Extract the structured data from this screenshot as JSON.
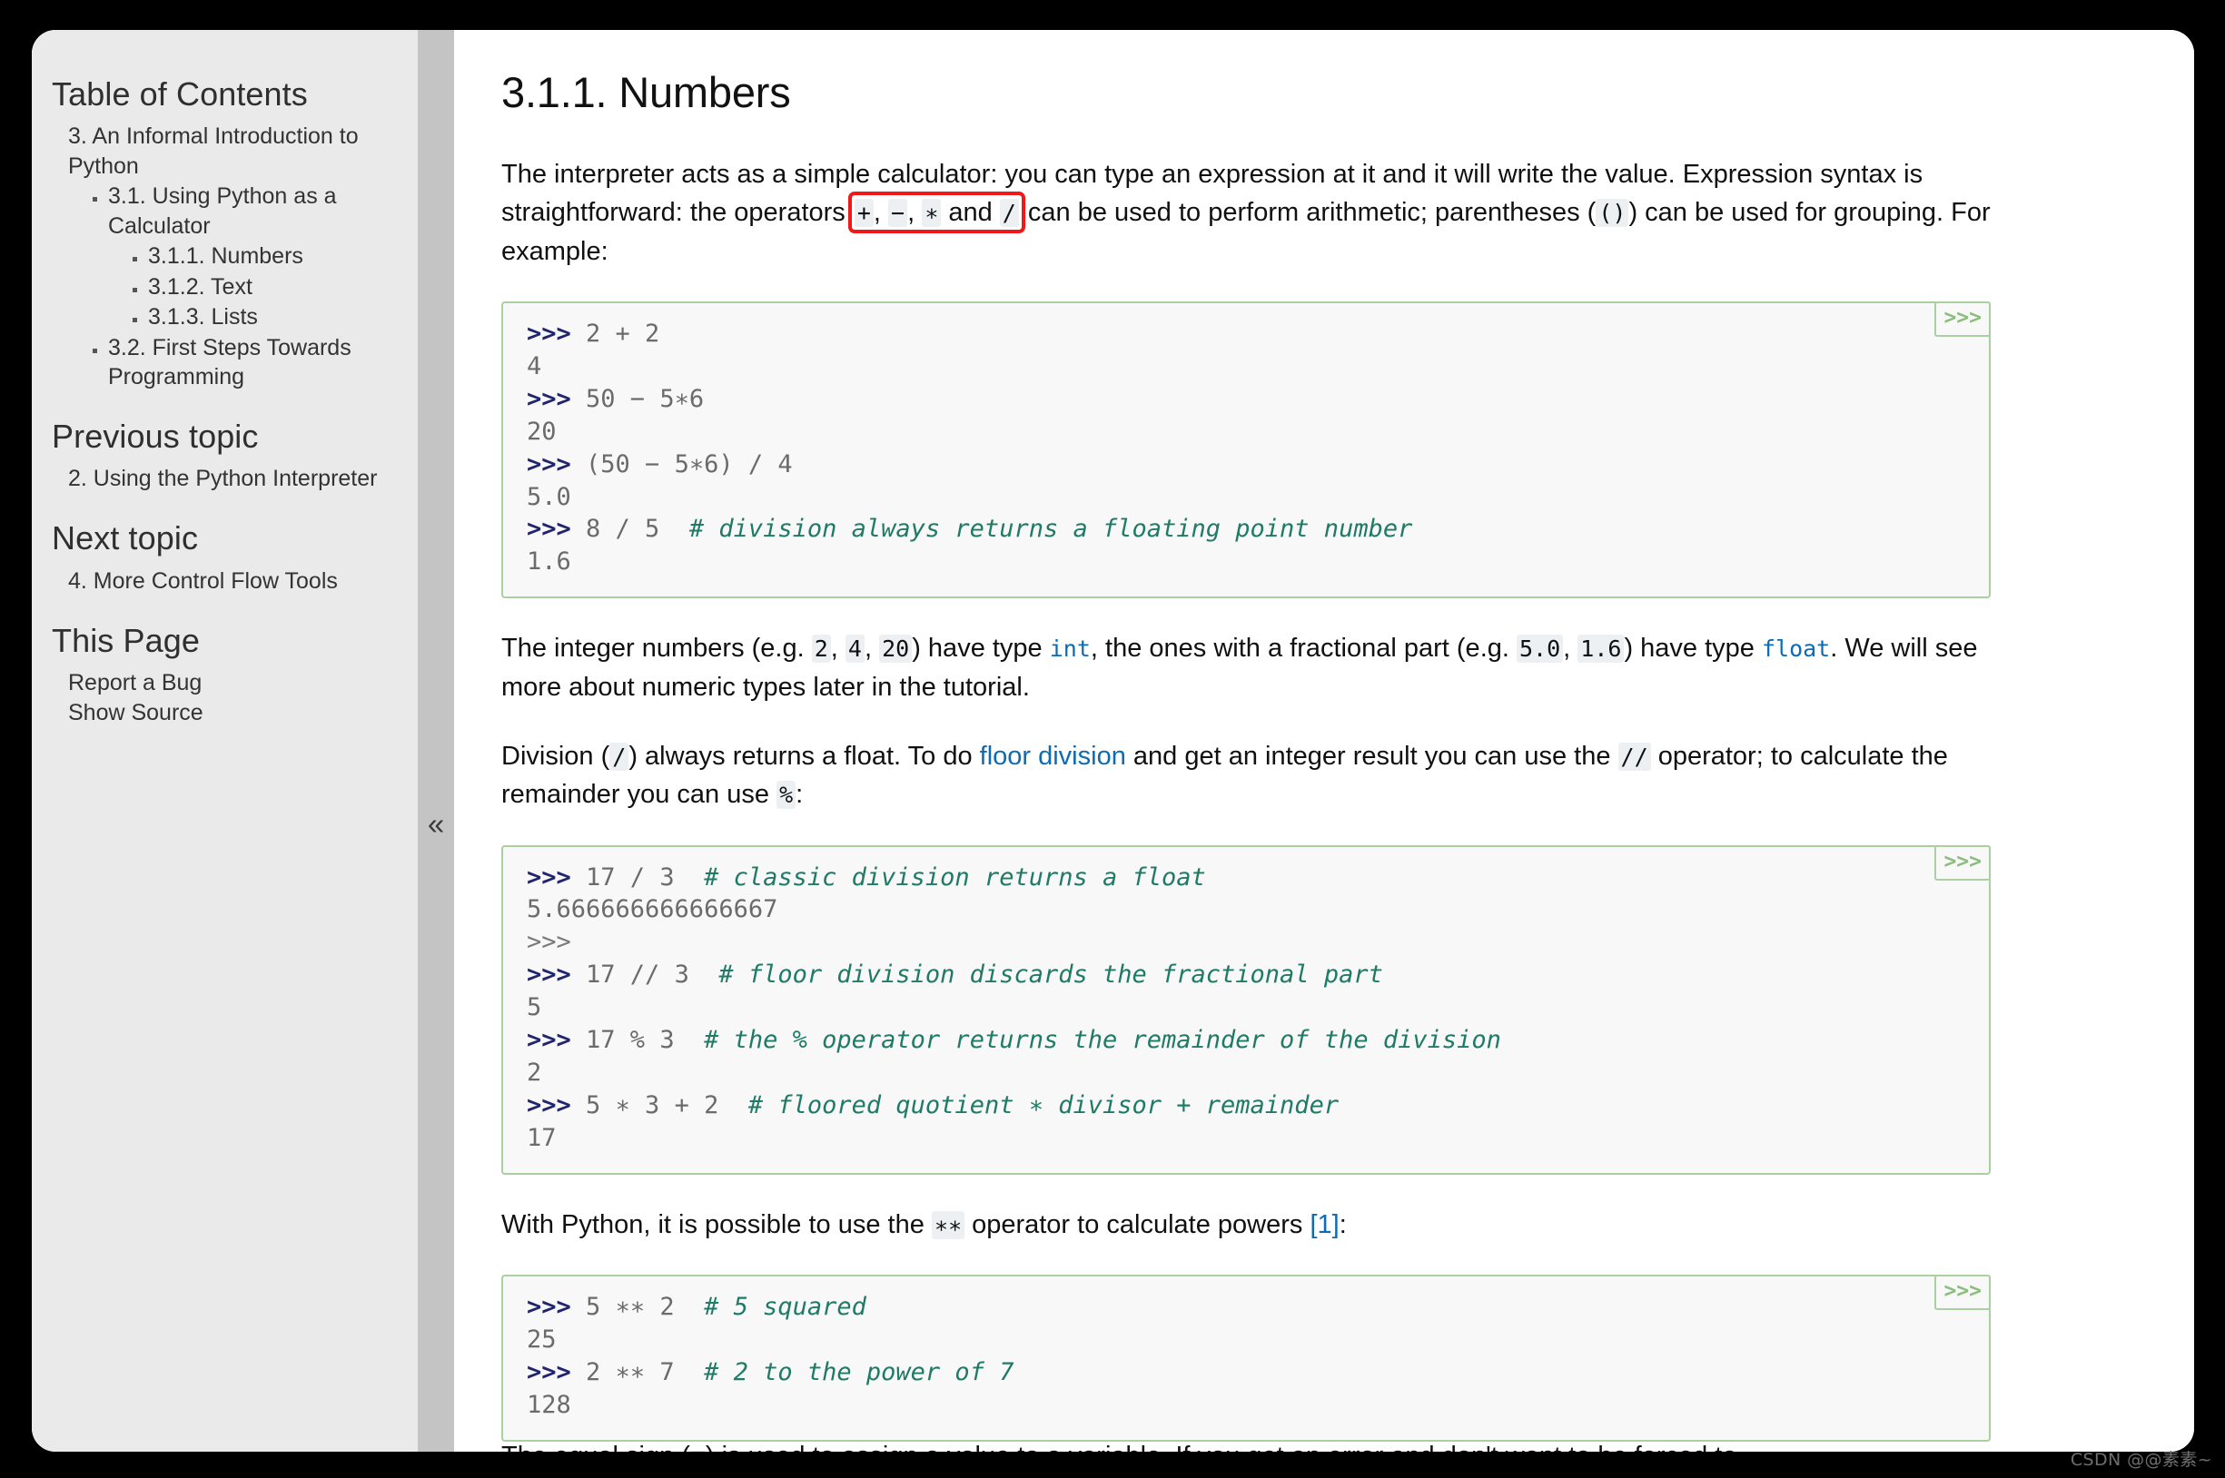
{
  "sidebar": {
    "toc_heading": "Table of Contents",
    "toc": {
      "root_label": "3. An Informal Introduction to Python",
      "children": [
        {
          "label": "3.1. Using Python as a Calculator",
          "children": [
            {
              "label": "3.1.1. Numbers"
            },
            {
              "label": "3.1.2. Text"
            },
            {
              "label": "3.1.3. Lists"
            }
          ]
        },
        {
          "label": "3.2. First Steps Towards Programming"
        }
      ]
    },
    "previous_topic_heading": "Previous topic",
    "previous_topic_link": "2. Using the Python Interpreter",
    "next_topic_heading": "Next topic",
    "next_topic_link": "4. More Control Flow Tools",
    "this_page_heading": "This Page",
    "this_page_links": [
      "Report a Bug",
      "Show Source"
    ],
    "collapse_glyph": "«"
  },
  "main": {
    "title": "3.1.1. Numbers",
    "para1": {
      "t1": "The interpreter acts as a simple calculator: you can type an expression at it and it will write the value. Expression syntax is straightforward: the operators ",
      "ops": [
        "+",
        ", ",
        "−",
        ", ",
        "∗",
        " and ",
        "/"
      ],
      "op_plus": "+",
      "op_minus": "−",
      "op_times": "∗",
      "op_div": "/",
      "op_sep1": ", ",
      "op_sep2": ", ",
      "op_and": " and ",
      "t2": " can be used to perform arithmetic; parentheses (",
      "parens": "()",
      "t3": ") can be used for grouping. For example:"
    },
    "code1": {
      "button_label": ">>>",
      "lines": [
        {
          "prompt": ">>>",
          "code": " 2 + 2",
          "comment": ""
        },
        {
          "prompt": "",
          "code": "4",
          "comment": ""
        },
        {
          "prompt": ">>>",
          "code": " 50 − 5∗6",
          "comment": ""
        },
        {
          "prompt": "",
          "code": "20",
          "comment": ""
        },
        {
          "prompt": ">>>",
          "code": " (50 − 5∗6) / 4",
          "comment": ""
        },
        {
          "prompt": "",
          "code": "5.0",
          "comment": ""
        },
        {
          "prompt": ">>>",
          "code": " 8 / 5  ",
          "comment": "# division always returns a floating point number"
        },
        {
          "prompt": "",
          "code": "1.6",
          "comment": ""
        }
      ]
    },
    "para2": {
      "t1": "The integer numbers (e.g. ",
      "c1": "2",
      "s1": ", ",
      "c2": "4",
      "s2": ", ",
      "c3": "20",
      "t2": ") have type ",
      "link_int": "int",
      "t3": ", the ones with a fractional part (e.g. ",
      "c4": "5.0",
      "s3": ", ",
      "c5": "1.6",
      "t4": ") have type ",
      "link_float": "float",
      "t5": ". We will see more about numeric types later in the tutorial."
    },
    "para3": {
      "t1": "Division (",
      "c1": "/",
      "t2": ") always returns a float. To do ",
      "link_floor": "floor division",
      "t3": " and get an integer result you can use the ",
      "c2": "//",
      "t4": " operator; to calculate the remainder you can use ",
      "c3": "%",
      "t5": ":"
    },
    "code2": {
      "button_label": ">>>",
      "lines": [
        {
          "prompt": ">>>",
          "code": " 17 / 3  ",
          "comment": "# classic division returns a float"
        },
        {
          "prompt": "",
          "code": "5.666666666666667",
          "comment": ""
        },
        {
          "prompt_plain": ">>>",
          "code": "",
          "comment": ""
        },
        {
          "prompt": ">>>",
          "code": " 17 // 3  ",
          "comment": "# floor division discards the fractional part"
        },
        {
          "prompt": "",
          "code": "5",
          "comment": ""
        },
        {
          "prompt": ">>>",
          "code": " 17 % 3  ",
          "comment": "# the % operator returns the remainder of the division"
        },
        {
          "prompt": "",
          "code": "2",
          "comment": ""
        },
        {
          "prompt": ">>>",
          "code": " 5 ∗ 3 + 2  ",
          "comment": "# floored quotient ∗ divisor + remainder"
        },
        {
          "prompt": "",
          "code": "17",
          "comment": ""
        }
      ]
    },
    "para4": {
      "t1": "With Python, it is possible to use the ",
      "c1": "∗∗",
      "t2": " operator to calculate powers ",
      "footnote": "[1]",
      "t3": ":"
    },
    "code3": {
      "button_label": ">>>",
      "lines": [
        {
          "prompt": ">>>",
          "code": " 5 ∗∗ 2  ",
          "comment": "# 5 squared"
        },
        {
          "prompt": "",
          "code": "25",
          "comment": ""
        },
        {
          "prompt": ">>>",
          "code": " 2 ∗∗ 7  ",
          "comment": "# 2 to the power of 7"
        },
        {
          "prompt": "",
          "code": "128",
          "comment": ""
        }
      ]
    },
    "para5_clipped": "The equal sign (=) is used to assign a value to a variable. If you get an error and don't want to be forced to"
  },
  "watermark": "CSDN @@素素~",
  "colors": {
    "page_bg": "#000000",
    "doc_bg": "#ffffff",
    "sidebar_bg": "#eaeaea",
    "divider": "#c4c4c4",
    "code_border": "#aacfa0",
    "code_bg": "#f7f8f7",
    "prompt": "#20256e",
    "comment": "#1f7a66",
    "link": "#0b6cb5",
    "highlight_box": "#f01818",
    "inline_code_bg": "#ecf0f3"
  }
}
